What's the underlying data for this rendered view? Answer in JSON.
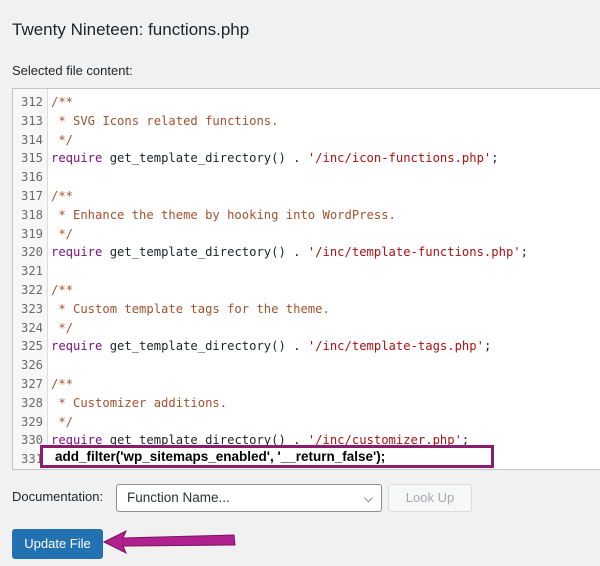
{
  "header": {
    "title": "Twenty Nineteen: functions.php",
    "selected_label": "Selected file content:"
  },
  "editor": {
    "lines": [
      {
        "num": "312",
        "parts": [
          {
            "t": "/**",
            "c": "comment"
          }
        ]
      },
      {
        "num": "313",
        "parts": [
          {
            "t": " * SVG Icons related functions.",
            "c": "comment"
          }
        ]
      },
      {
        "num": "314",
        "parts": [
          {
            "t": " */",
            "c": "comment"
          }
        ]
      },
      {
        "num": "315",
        "parts": [
          {
            "t": "require",
            "c": "kw"
          },
          {
            "t": " get_template_directory() . ",
            "c": "plain"
          },
          {
            "t": "'/inc/icon-functions.php'",
            "c": "str"
          },
          {
            "t": ";",
            "c": "plain"
          }
        ]
      },
      {
        "num": "316",
        "parts": []
      },
      {
        "num": "317",
        "parts": [
          {
            "t": "/**",
            "c": "comment"
          }
        ]
      },
      {
        "num": "318",
        "parts": [
          {
            "t": " * Enhance the theme by hooking into WordPress.",
            "c": "comment"
          }
        ]
      },
      {
        "num": "319",
        "parts": [
          {
            "t": " */",
            "c": "comment"
          }
        ]
      },
      {
        "num": "320",
        "parts": [
          {
            "t": "require",
            "c": "kw"
          },
          {
            "t": " get_template_directory() . ",
            "c": "plain"
          },
          {
            "t": "'/inc/template-functions.php'",
            "c": "str"
          },
          {
            "t": ";",
            "c": "plain"
          }
        ]
      },
      {
        "num": "321",
        "parts": []
      },
      {
        "num": "322",
        "parts": [
          {
            "t": "/**",
            "c": "comment"
          }
        ]
      },
      {
        "num": "323",
        "parts": [
          {
            "t": " * Custom template tags for the theme.",
            "c": "comment"
          }
        ]
      },
      {
        "num": "324",
        "parts": [
          {
            "t": " */",
            "c": "comment"
          }
        ]
      },
      {
        "num": "325",
        "parts": [
          {
            "t": "require",
            "c": "kw"
          },
          {
            "t": " get_template_directory() . ",
            "c": "plain"
          },
          {
            "t": "'/inc/template-tags.php'",
            "c": "str"
          },
          {
            "t": ";",
            "c": "plain"
          }
        ]
      },
      {
        "num": "326",
        "parts": []
      },
      {
        "num": "327",
        "parts": [
          {
            "t": "/**",
            "c": "comment"
          }
        ]
      },
      {
        "num": "328",
        "parts": [
          {
            "t": " * Customizer additions.",
            "c": "comment"
          }
        ]
      },
      {
        "num": "329",
        "parts": [
          {
            "t": " */",
            "c": "comment"
          }
        ]
      },
      {
        "num": "330",
        "parts": [
          {
            "t": "require",
            "c": "kw"
          },
          {
            "t": " get_template_directory() . ",
            "c": "plain"
          },
          {
            "t": "'/inc/customizer.php'",
            "c": "str"
          },
          {
            "t": ";",
            "c": "plain"
          }
        ]
      },
      {
        "num": "331",
        "parts": []
      }
    ],
    "added_code": "add_filter('wp_sitemaps_enabled', '__return_false');"
  },
  "documentation": {
    "label": "Documentation:",
    "select_value": "Function Name...",
    "lookup_label": "Look Up"
  },
  "actions": {
    "update_label": "Update File"
  },
  "colors": {
    "highlight_border": "#8b1e6c",
    "arrow": "#b0208e",
    "primary": "#2271b1"
  }
}
